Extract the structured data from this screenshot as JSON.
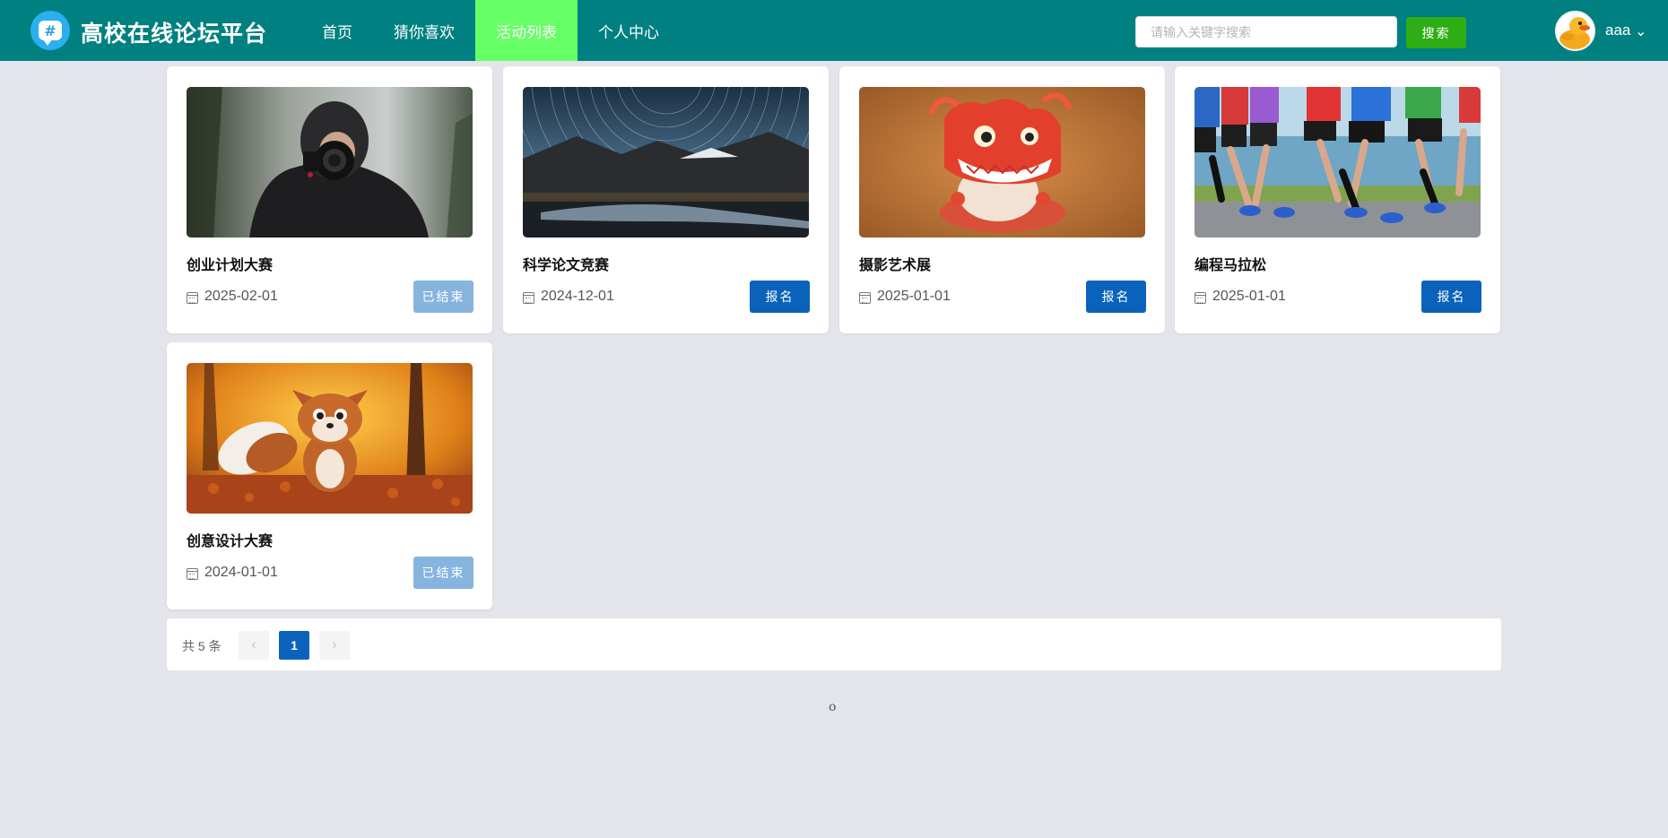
{
  "header": {
    "site_title": "高校在线论坛平台",
    "logo_glyph": "#",
    "nav": [
      {
        "label": "首页",
        "active": false
      },
      {
        "label": "猜你喜欢",
        "active": false
      },
      {
        "label": "活动列表",
        "active": true
      },
      {
        "label": "个人中心",
        "active": false
      }
    ],
    "search": {
      "placeholder": "请输入关键字搜索",
      "value": "",
      "button_label": "搜索"
    },
    "user": {
      "name": "aaa",
      "caret": "⌄"
    }
  },
  "cards": [
    {
      "title": "创业计划大赛",
      "date": "2025-02-01",
      "button": "已结束",
      "state": "ended",
      "image": "photographer-image"
    },
    {
      "title": "科学论文竞赛",
      "date": "2024-12-01",
      "button": "报名",
      "state": "open",
      "image": "star-trails-image"
    },
    {
      "title": "摄影艺术展",
      "date": "2025-01-01",
      "button": "报名",
      "state": "open",
      "image": "red-dragon-image"
    },
    {
      "title": "编程马拉松",
      "date": "2025-01-01",
      "button": "报名",
      "state": "open",
      "image": "runners-image"
    },
    {
      "title": "创意设计大赛",
      "date": "2024-01-01",
      "button": "已结束",
      "state": "ended",
      "image": "fox-image"
    }
  ],
  "pagination": {
    "total_text": "共 5 条",
    "current_page": "1",
    "prev": "‹",
    "next": "›"
  },
  "footer": {
    "text": "o"
  },
  "colors": {
    "header": "#008080",
    "nav_active": "#66ff66",
    "search_button": "#2eae14",
    "primary": "#0a62bb",
    "disabled": "#87b4de"
  }
}
